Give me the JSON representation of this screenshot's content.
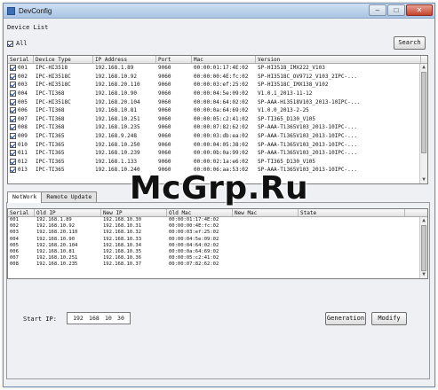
{
  "window": {
    "title": "DevConfig"
  },
  "device_list": {
    "label": "Device List",
    "all_label": "All",
    "all_checked": true,
    "search_label": "Search",
    "columns": [
      "Serial",
      "Device Type",
      "IP Address",
      "Port",
      "Mac",
      "Version"
    ],
    "rows": [
      {
        "serial": "001",
        "type": "IPC-HI3518",
        "ip": "192.168.1.89",
        "port": "9060",
        "mac": "00:00:01:17:4E:02",
        "version": "SP-HI3518_IMX222_V103",
        "checked": true
      },
      {
        "serial": "002",
        "type": "IPC-HI3518C",
        "ip": "192.168.10.92",
        "port": "9060",
        "mac": "00:00:00:4E:fc:02",
        "version": "SP-HI3518C_OV9712_V103_2IPC-...",
        "checked": true
      },
      {
        "serial": "003",
        "type": "IPC-HI3518C",
        "ip": "192.168.20.110",
        "port": "9060",
        "mac": "00:00:03:ef:25:02",
        "version": "SP-HI3518C_IMX138_V102",
        "checked": true
      },
      {
        "serial": "004",
        "type": "IPC-TI368",
        "ip": "192.168.10.90",
        "port": "9060",
        "mac": "00:00:04:5e:09:02",
        "version": "V1.0.1_2013-11-12",
        "checked": true
      },
      {
        "serial": "005",
        "type": "IPC-HI3518C",
        "ip": "192.168.20.104",
        "port": "9060",
        "mac": "00:00:04:64:02:02",
        "version": "SP-AAA-Hi3518V103_2013-10IPC-...",
        "checked": true
      },
      {
        "serial": "006",
        "type": "IPC-TI368",
        "ip": "192.168.10.81",
        "port": "9060",
        "mac": "00:00:0a:64:69:02",
        "version": "V1.0.0_2013-2-25",
        "checked": true
      },
      {
        "serial": "007",
        "type": "IPC-TI368",
        "ip": "192.168.10.251",
        "port": "9060",
        "mac": "00:00:05:c2:41:02",
        "version": "SP-TI365_D130_V105",
        "checked": true
      },
      {
        "serial": "008",
        "type": "IPC-TI368",
        "ip": "192.168.10.235",
        "port": "9060",
        "mac": "00:00:07:82:62:02",
        "version": "SP-AAA-Ti365V103_2013-10IPC-...",
        "checked": true
      },
      {
        "serial": "009",
        "type": "IPC-TI365",
        "ip": "192.168.9.248",
        "port": "9060",
        "mac": "00:00:03:db:ea:02",
        "version": "SP-AAA-Ti365V103_2013-10IPC-...",
        "checked": true
      },
      {
        "serial": "010",
        "type": "IPC-TI365",
        "ip": "192.168.10.250",
        "port": "9060",
        "mac": "00:00:04:05:38:02",
        "version": "SP-AAA-Ti365V103_2013-10IPC-...",
        "checked": true
      },
      {
        "serial": "011",
        "type": "IPC-TI365",
        "ip": "192.168.10.239",
        "port": "9060",
        "mac": "00:00:0b:0a:99:02",
        "version": "SP-AAA-Ti365V103_2013-10IPC-...",
        "checked": true
      },
      {
        "serial": "012",
        "type": "IPC-TI365",
        "ip": "192.168.1.133",
        "port": "9060",
        "mac": "00:00:02:1a:e6:02",
        "version": "SP-TI365_D130_V105",
        "checked": true
      },
      {
        "serial": "013",
        "type": "IPC-TI365",
        "ip": "192.168.10.240",
        "port": "9060",
        "mac": "00:00:06:aa:53:02",
        "version": "SP-AAA-Ti365V103_2013-10IPC-...",
        "checked": true
      }
    ]
  },
  "tabs": [
    {
      "label": "NetWork",
      "active": true
    },
    {
      "label": "Remote Update",
      "active": false
    }
  ],
  "netlog": {
    "columns": [
      "Serial",
      "Old IP",
      "New IP",
      "Old Mac",
      "New Mac",
      "State"
    ],
    "rows": [
      {
        "serial": "001",
        "old_ip": "192.168.1.89",
        "new_ip": "192.168.10.30",
        "old_mac": "00:00:01:17:4E:02"
      },
      {
        "serial": "002",
        "old_ip": "192.168.10.92",
        "new_ip": "192.168.10.31",
        "old_mac": "00:00:00:4E:fc:02"
      },
      {
        "serial": "003",
        "old_ip": "192.168.20.110",
        "new_ip": "192.168.10.32",
        "old_mac": "00:00:03:ef:25:02"
      },
      {
        "serial": "004",
        "old_ip": "192.168.10.90",
        "new_ip": "192.168.10.33",
        "old_mac": "00:00:04:5e:09:02"
      },
      {
        "serial": "005",
        "old_ip": "192.168.20.104",
        "new_ip": "192.168.10.34",
        "old_mac": "00:00:04:64:02:02"
      },
      {
        "serial": "006",
        "old_ip": "192.168.10.81",
        "new_ip": "192.168.10.35",
        "old_mac": "00:00:0a:64:69:02"
      },
      {
        "serial": "007",
        "old_ip": "192.168.10.251",
        "new_ip": "192.168.10.36",
        "old_mac": "00:00:05:c2:41:02"
      },
      {
        "serial": "008",
        "old_ip": "192.168.10.235",
        "new_ip": "192.168.10.37",
        "old_mac": "00:00:07:82:62:02"
      }
    ]
  },
  "network": {
    "start_ip_label": "Start IP:",
    "start_ip": [
      "192",
      "168",
      "10",
      "30"
    ],
    "generation_label": "Generation",
    "modify_label": "Modify"
  },
  "watermark": "McGrp.Ru"
}
